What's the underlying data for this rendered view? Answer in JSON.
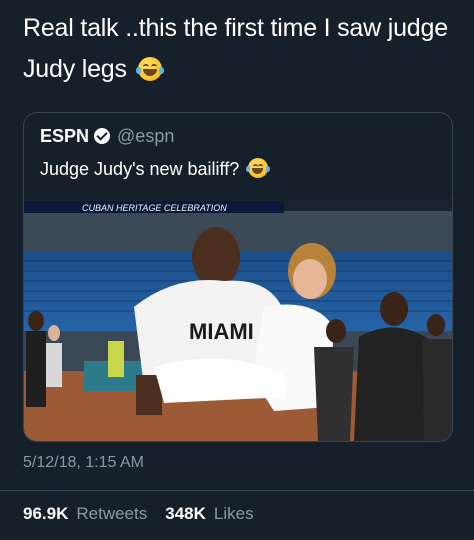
{
  "tweet": {
    "text_line1": "Real talk ..this the first time I saw judge",
    "text_line2": "Judy legs"
  },
  "quoted_tweet": {
    "name": "ESPN",
    "handle": "@espn",
    "text": "Judge Judy's new bailiff?",
    "photo_banner": "CUBAN HERITAGE CELEBRATION",
    "photo_jersey": "MIAMI"
  },
  "timestamp": "5/12/18, 1:15 AM",
  "stats": {
    "retweets_count": "96.9K",
    "retweets_label": "Retweets",
    "likes_count": "348K",
    "likes_label": "Likes"
  },
  "icons": [
    "laughing-tears-emoji-icon",
    "verified-badge-icon"
  ],
  "colors": {
    "background": "#15202b",
    "secondary_text": "#8899a6",
    "border": "#38444d"
  }
}
